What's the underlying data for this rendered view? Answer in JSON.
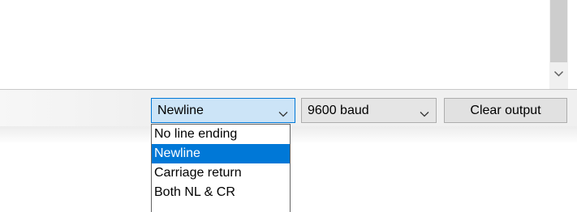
{
  "output": {
    "scroll_down_icon": "chevron-down-icon"
  },
  "controls": {
    "line_ending": {
      "value": "Newline",
      "options": [
        "No line ending",
        "Newline",
        "Carriage return",
        "Both NL & CR"
      ],
      "selected_index": 1
    },
    "baud_rate": {
      "value": "9600 baud"
    },
    "clear_label": "Clear output"
  },
  "colors": {
    "selection": "#0078d7",
    "focused_combo_bg": "#cce4f7",
    "bar_bg": "#f0f0f0",
    "button_bg": "#e1e1e1"
  }
}
